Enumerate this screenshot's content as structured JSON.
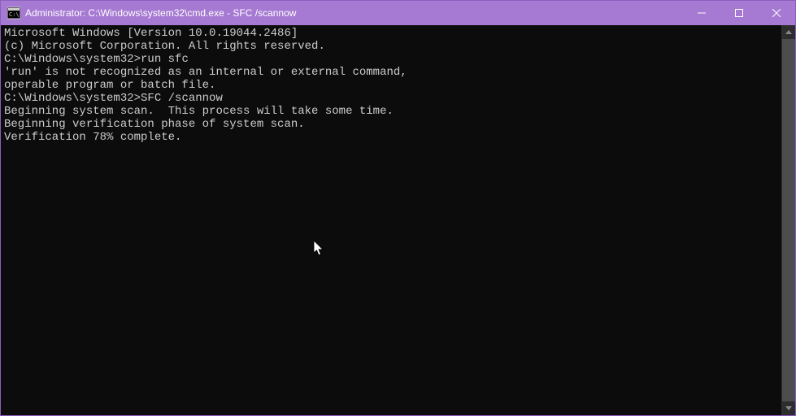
{
  "titlebar": {
    "title": "Administrator: C:\\Windows\\system32\\cmd.exe - SFC  /scannow"
  },
  "terminal": {
    "line1": "Microsoft Windows [Version 10.0.19044.2486]",
    "line2": "(c) Microsoft Corporation. All rights reserved.",
    "blank1": "",
    "prompt1": "C:\\Windows\\system32>",
    "cmd1": "run sfc",
    "err1a": "'run' is not recognized as an internal or external command,",
    "err1b": "operable program or batch file.",
    "blank2": "",
    "prompt2": "C:\\Windows\\system32>",
    "cmd2": "SFC /scannow",
    "blank3": "",
    "scan1": "Beginning system scan.  This process will take some time.",
    "blank4": "",
    "scan2": "Beginning verification phase of system scan.",
    "scan3": "Verification 78% complete."
  }
}
